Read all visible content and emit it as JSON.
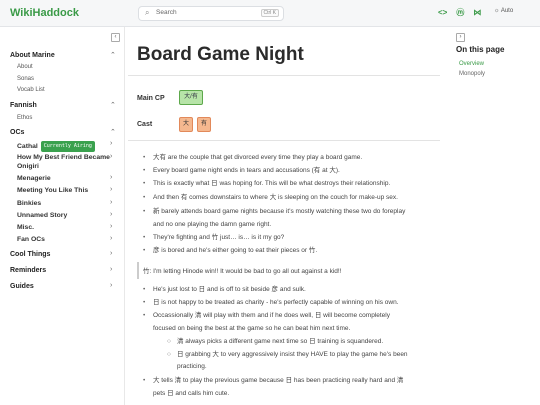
{
  "header": {
    "logo": "WikiHaddock",
    "search_placeholder": "Search",
    "search_shortcut": "Ctrl K",
    "theme_label": "Auto"
  },
  "sidebar": {
    "sections": [
      {
        "label": "About Marine",
        "items": [
          "About",
          "Sonas",
          "Vocab List"
        ]
      },
      {
        "label": "Fannish",
        "items": [
          "Ethos"
        ]
      },
      {
        "label": "OCs"
      },
      {
        "label": "Cool Things"
      },
      {
        "label": "Reminders"
      },
      {
        "label": "Guides"
      }
    ],
    "ocs": [
      {
        "label": "Cathal",
        "badge": "Currently Airing"
      },
      {
        "label": "How My Best Friend Became Onigiri"
      },
      {
        "label": "Menagerie"
      },
      {
        "label": "Meeting You Like This"
      },
      {
        "label": "Binkies"
      },
      {
        "label": "Unnamed Story"
      },
      {
        "label": "Misc."
      },
      {
        "label": "Fan OCs"
      }
    ]
  },
  "page": {
    "title": "Board Game Night",
    "main_cp_label": "Main CP",
    "main_cp_chip": "大/有",
    "cast_label": "Cast",
    "cast_chips": [
      "大",
      "有"
    ]
  },
  "bullets": [
    "大有 are the couple that get divorced every time they play a board game.",
    "Every board game night ends in tears and accusations (有 at 大).",
    "This is exactly what 日 was hoping for. This will be what destroys their relationship.",
    "And then 有 comes downstairs to where 大 is sleeping on the couch for make-up sex.",
    "新 barely attends board game nights because it's mostly watching these two do foreplay",
    "and no one playing the damn game right.",
    "They're fighting and 竹 just… is… is it my go?",
    "彦 is bored and he's either going to eat their pieces or 竹."
  ],
  "quote": "竹: I'm letting Hinode win!! It would be bad to go all out against a kid!!",
  "bullets2": [
    "He's just lost to 日 and is off to sit beside 彦 and sulk.",
    "日 is not happy to be treated as charity - he's perfectly capable of winning on his own.",
    "Occassionally 清 will play with them and if he does well, 日 will become completely",
    "focused on being the best at the game so he can beat him next time."
  ],
  "sub_bullets": [
    "清 always picks a different game next time so 日 training is squandered.",
    "日 grabbing 大 to very aggressively insist they HAVE to play the game he's been",
    "practicing."
  ],
  "bullets3": [
    "大 tells 清 to play the previous game because 日 has been practicing really hard and 清",
    "pets 日 and calls him cute."
  ],
  "toc": {
    "title": "On this page",
    "items": [
      "Overview",
      "Monopoly"
    ]
  },
  "colors": {
    "accent": "#3a9a47",
    "chip_green": "#b7e4a8",
    "chip_orange": "#f5b88f",
    "badge": "#3aa14e"
  }
}
